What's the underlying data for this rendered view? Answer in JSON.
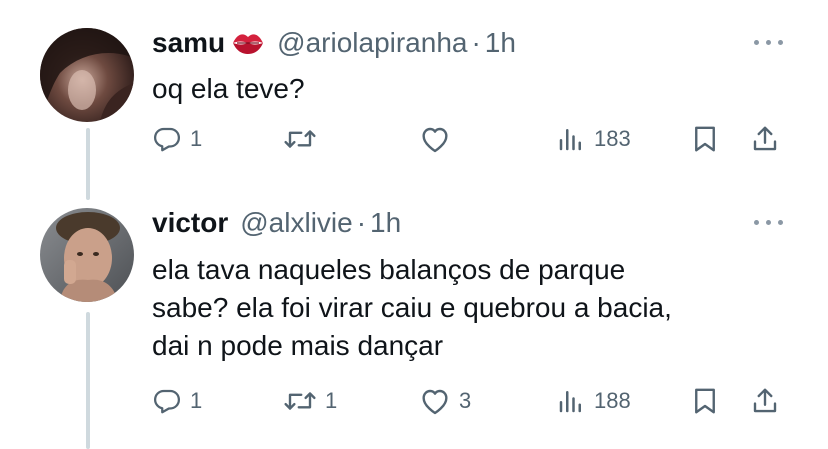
{
  "tweets": [
    {
      "name": "samu",
      "handle": "@ariolapiranha",
      "dot": "·",
      "time": "1h",
      "text": "oq ela teve?",
      "name_emoji": "kiss-mark",
      "replies": "1",
      "retweets": "",
      "likes": "",
      "views": "183"
    },
    {
      "name": "victor",
      "handle": "@alxlivie",
      "dot": "·",
      "time": "1h",
      "text": "ela tava naqueles balanços de parque\nsabe? ela foi virar caiu e quebrou a bacia,\ndai n pode mais dançar",
      "replies": "1",
      "retweets": "1",
      "likes": "3",
      "views": "188"
    }
  ],
  "colors": {
    "text": "#0f1419",
    "secondary": "#536471",
    "thread_line": "#cfd9de",
    "emoji_red": "#d4213d"
  },
  "icons": [
    "reply-icon",
    "retweet-icon",
    "like-icon",
    "views-icon",
    "bookmark-icon",
    "share-icon",
    "more-icon"
  ]
}
